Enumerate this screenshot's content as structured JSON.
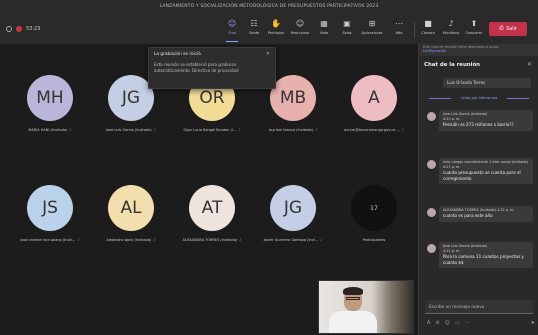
{
  "window": {
    "title": "LANZAMIENTO Y SOCIALIZACIÓN METODOLÓGICA DE PRESUPUESTOS PARTICIPATIVOS 2023"
  },
  "toolbar": {
    "timer": "53:23",
    "buttons": [
      {
        "label": "Chat",
        "icon": "chat-icon",
        "glyph": "☺"
      },
      {
        "label": "Gente",
        "icon": "people-icon",
        "glyph": "☷"
      },
      {
        "label": "Participar",
        "icon": "raise-hand-icon",
        "glyph": "✋"
      },
      {
        "label": "Reaccionar",
        "icon": "reaction-icon",
        "glyph": "☺"
      },
      {
        "label": "Vista",
        "icon": "view-icon",
        "glyph": "▦"
      },
      {
        "label": "Salas",
        "icon": "rooms-icon",
        "glyph": "▣"
      },
      {
        "label": "Aplicaciones",
        "icon": "apps-icon",
        "glyph": "⊞"
      },
      {
        "label": "Más",
        "icon": "more-icon",
        "glyph": "⋯"
      }
    ],
    "media": [
      {
        "label": "Cámara",
        "icon": "camera-icon",
        "glyph": "■"
      },
      {
        "label": "Micrófono",
        "icon": "microphone-icon",
        "glyph": "♪"
      },
      {
        "label": "Compartir",
        "icon": "share-icon",
        "glyph": "⬆"
      }
    ],
    "leave_label": "Salir",
    "leave_color": "#c4314b"
  },
  "notification": {
    "title": "La grabación se inició.",
    "body": "Esta reunión se estableció para grabarse automáticamente. Directiva de privacidad"
  },
  "participants": [
    {
      "initials": "MH",
      "name": "MARIA HANI (Invitado)",
      "color": "#b9b6d9"
    },
    {
      "initials": "JG",
      "name": "Jose Luis Garcia (Invitado)",
      "color": "#c4cfe6"
    },
    {
      "initials": "OR",
      "name": "Olga Lucia Rangel Rondon (I...",
      "color": "#f2dd97"
    },
    {
      "initials": "MB",
      "name": "myriam blanco (Invitado)",
      "color": "#e7b2ad"
    },
    {
      "initials": "A",
      "name": "anrym@bucaramanga.gov.co ...",
      "color": "#eebdc3"
    },
    {
      "initials": "JS",
      "name": "jose vicente ruiz solano (Invit...",
      "color": "#bad3ea"
    },
    {
      "initials": "AL",
      "name": "Alejandro lopez (Invitado)",
      "color": "#f3dfae"
    },
    {
      "initials": "AT",
      "name": "ALEXANDRA TORRES (Invitado)",
      "color": "#ede4de"
    },
    {
      "initials": "JG",
      "name": "Javier Guerrero Gamboa (Invi...",
      "color": "#c4cfe6"
    },
    {
      "initials": "17",
      "name": "Participantes",
      "color": "#111111"
    }
  ],
  "chat": {
    "title": "Chat de la reunión",
    "banner_text": "Este chat de reunión tiene detectado el audio",
    "banner_link": "Configuración",
    "previous_sender": "Luis Orlando Torres",
    "unread_label": "Leído por última vez",
    "messages": [
      {
        "sender": "Jose Luis Garcia (Invitado)",
        "time": "4:20 p. m.",
        "text": "Pensión es 273 millones x barrio??"
      },
      {
        "sender": "erby vargas concejimiento 1 lider social (Invitado)",
        "time": "4:21 p. m.",
        "text": "cuanto presupuesto se cuenta para el corregimiento"
      },
      {
        "sender": "ALEXANDRA TORRES (Invitado)",
        "time": "4:22 p. m.",
        "text": "cuanto es para este año"
      },
      {
        "sender": "Jose Luis Garcia (Invitado)",
        "time": "4:22 p. m.",
        "text": "Para la comuna 11 cuantos proyectos y cuanto $$"
      }
    ],
    "compose_placeholder": "Escribe un mensaje nuevo"
  }
}
